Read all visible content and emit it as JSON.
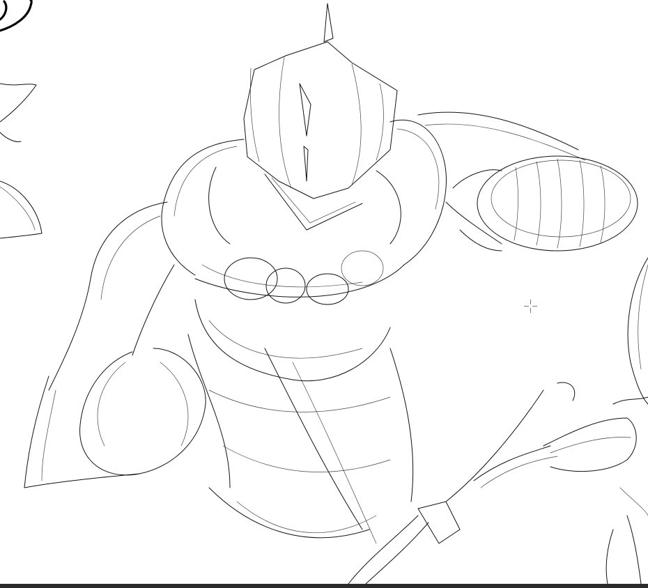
{
  "canvas": {
    "background": "#ffffff",
    "ink_color": "#111111",
    "content": "pencil-sketch"
  },
  "cursor": {
    "icon": "crosshair-icon"
  },
  "bottom_bar": {
    "color": "#2b2b2b"
  }
}
